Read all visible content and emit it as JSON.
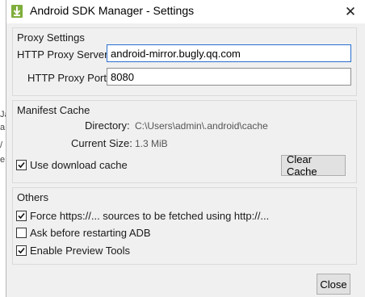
{
  "window": {
    "title": "Android SDK Manager - Settings",
    "close_glyph": "✕"
  },
  "proxy": {
    "section_title": "Proxy Settings",
    "server_label": "HTTP Proxy Server",
    "server_value": "android-mirror.bugly.qq.com",
    "port_label": "HTTP Proxy Port",
    "port_value": "8080"
  },
  "manifest": {
    "section_title": "Manifest Cache",
    "directory_label": "Directory:",
    "directory_value": "C:\\Users\\admin\\.android\\cache",
    "size_label": "Current Size:",
    "size_value": "1.3 MiB",
    "use_cache_label": "Use download cache",
    "use_cache_checked": true,
    "clear_button": "Clear Cache"
  },
  "others": {
    "section_title": "Others",
    "options": [
      {
        "label": "Force https://... sources to be fetched using http://...",
        "checked": true
      },
      {
        "label": "Ask before restarting ADB",
        "checked": false
      },
      {
        "label": "Enable Preview Tools",
        "checked": true
      }
    ]
  },
  "footer": {
    "close_button": "Close"
  },
  "background_fragments": [
    "Ja",
    "a",
    "/",
    "e"
  ]
}
